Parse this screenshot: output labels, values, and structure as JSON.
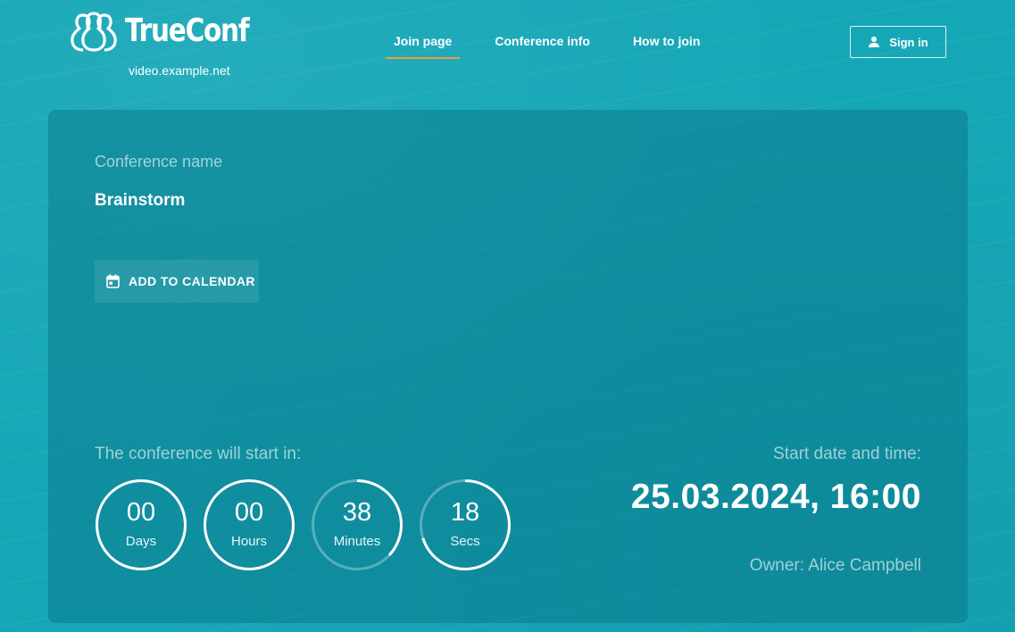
{
  "header": {
    "logo_text": "TrueConf",
    "domain": "video.example.net",
    "tabs": [
      {
        "label": "Join page",
        "active": true
      },
      {
        "label": "Conference info",
        "active": false
      },
      {
        "label": "How to join",
        "active": false
      }
    ],
    "signin_label": "Sign in",
    "signin_icon": "person-icon",
    "active_tab_color": "#f39c2f"
  },
  "conference": {
    "name_label": "Conference name",
    "name": "Brainstorm",
    "calendar_button_label": "ADD TO CALENDAR",
    "calendar_icon": "calendar-icon"
  },
  "countdown": {
    "label": "The conference will start in:",
    "timers": [
      {
        "value": "00",
        "unit": "Days",
        "progress": 1.0
      },
      {
        "value": "00",
        "unit": "Hours",
        "progress": 1.0
      },
      {
        "value": "38",
        "unit": "Minutes",
        "progress": 0.37
      },
      {
        "value": "18",
        "unit": "Secs",
        "progress": 0.7
      }
    ]
  },
  "schedule": {
    "start_label": "Start date and time:",
    "start_value": "25.03.2024, 16:00",
    "owner": "Owner: Alice Campbell"
  },
  "colors": {
    "background": "#16a7b7",
    "accent": "#f39c2f"
  }
}
